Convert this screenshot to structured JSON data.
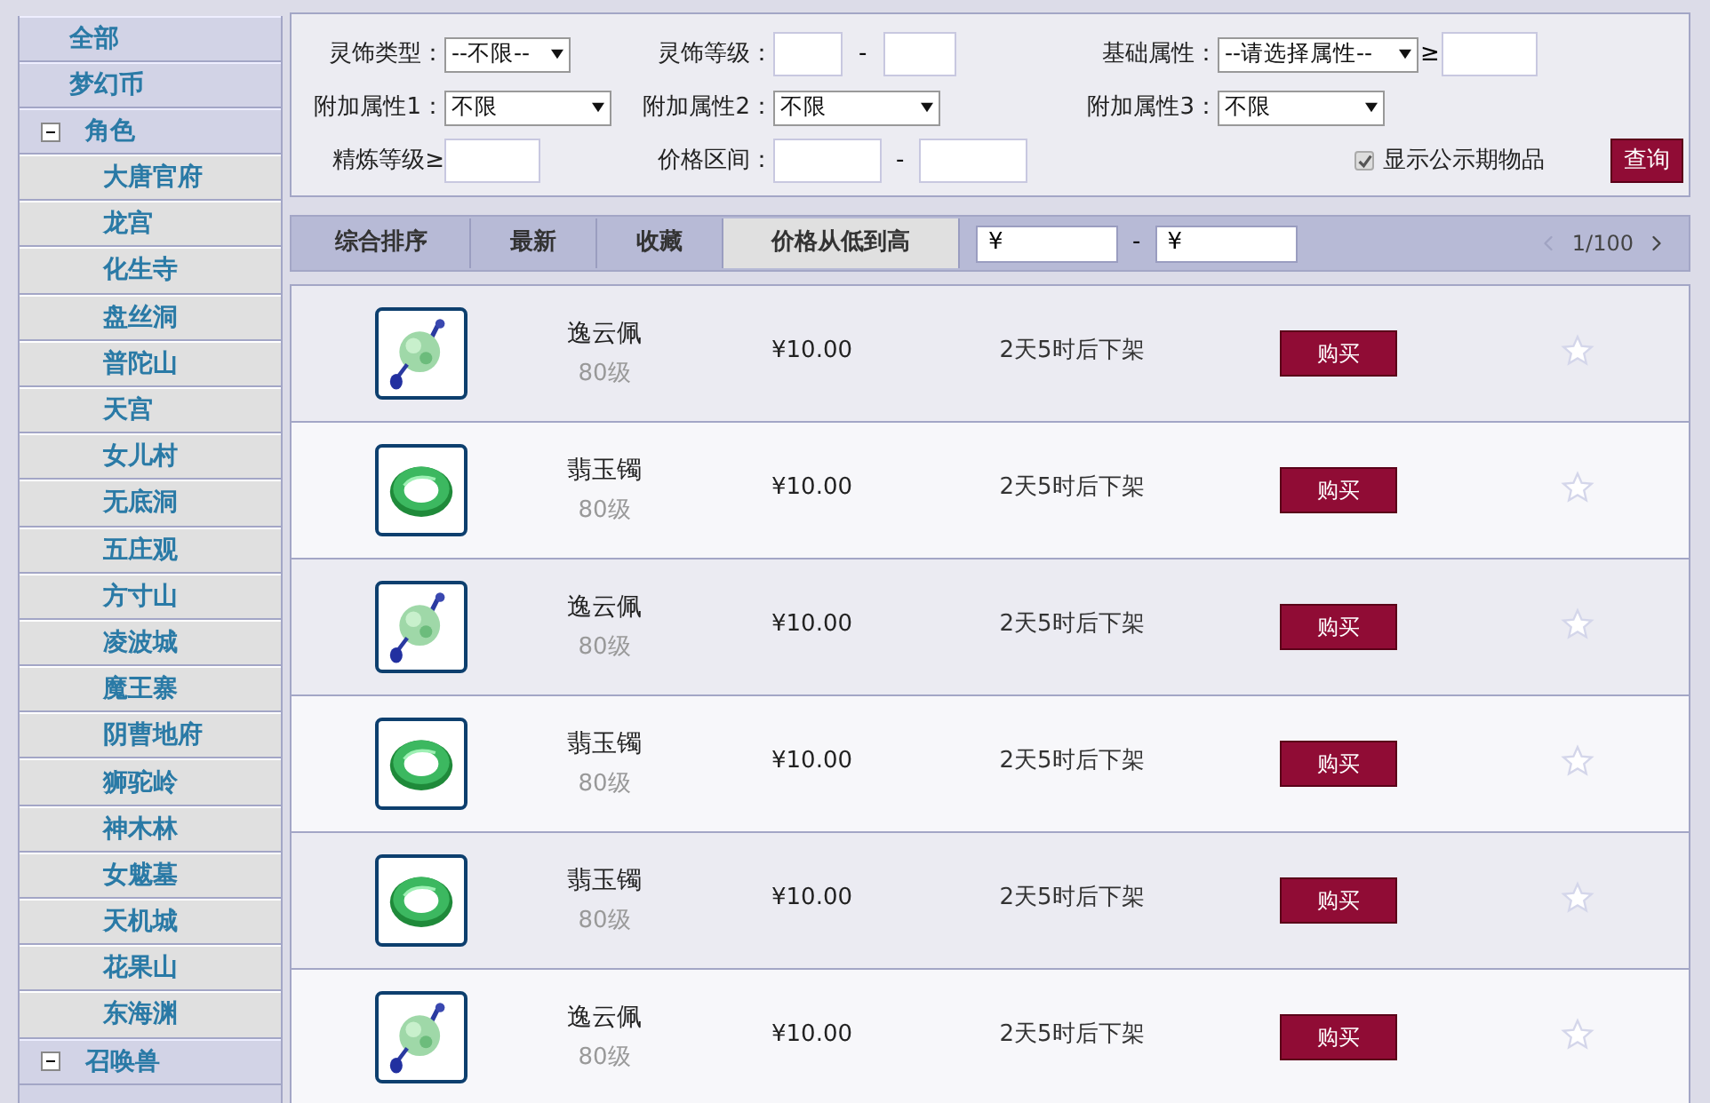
{
  "sidebar": {
    "items": [
      {
        "label": "全部",
        "kind": "top"
      },
      {
        "label": "梦幻币",
        "kind": "top"
      },
      {
        "label": "角色",
        "kind": "group",
        "expanded": true,
        "children": [
          {
            "label": "大唐官府"
          },
          {
            "label": "龙宫"
          },
          {
            "label": "化生寺"
          },
          {
            "label": "盘丝洞"
          },
          {
            "label": "普陀山"
          },
          {
            "label": "天宫"
          },
          {
            "label": "女儿村"
          },
          {
            "label": "无底洞"
          },
          {
            "label": "五庄观"
          },
          {
            "label": "方寸山"
          },
          {
            "label": "凌波城"
          },
          {
            "label": "魔王寨"
          },
          {
            "label": "阴曹地府"
          },
          {
            "label": "狮驼岭"
          },
          {
            "label": "神木林"
          },
          {
            "label": "女魃墓"
          },
          {
            "label": "天机城"
          },
          {
            "label": "花果山"
          },
          {
            "label": "东海渊"
          }
        ]
      },
      {
        "label": "召唤兽",
        "kind": "group",
        "expanded": true
      }
    ]
  },
  "filters": {
    "ornament_type": {
      "label": "灵饰类型：",
      "value": "--不限--"
    },
    "ornament_level": {
      "label": "灵饰等级：",
      "separator": "-"
    },
    "base_attribute": {
      "label": "基础属性：",
      "value": "--请选择属性--",
      "comparator": "≥"
    },
    "extra_attributes": [
      {
        "label": "附加属性1：",
        "value": "不限"
      },
      {
        "label": "附加属性2：",
        "value": "不限"
      },
      {
        "label": "附加属性3：",
        "value": "不限"
      }
    ],
    "refine_level": {
      "label": "精炼等级≥"
    },
    "price_range": {
      "label": "价格区间：",
      "separator": "-"
    },
    "show_public": {
      "label": "显示公示期物品",
      "checked": true
    },
    "query_button": "查询"
  },
  "sort_bar": {
    "tabs": [
      {
        "label": "综合排序",
        "selected": false
      },
      {
        "label": "最新",
        "selected": false
      },
      {
        "label": "收藏",
        "selected": false
      },
      {
        "label": "价格从低到高",
        "selected": true
      }
    ],
    "price_min": "¥",
    "separator": "-",
    "price_max": "¥",
    "pager": {
      "page": "1/100",
      "prev_disabled": true
    }
  },
  "items": [
    {
      "kind": "pendant",
      "name": "逸云佩",
      "level": "80级",
      "price": "¥10.00",
      "time_left": "2天5时后下架",
      "buy": "购买",
      "favorited": false
    },
    {
      "kind": "bracelet",
      "name": "翡玉镯",
      "level": "80级",
      "price": "¥10.00",
      "time_left": "2天5时后下架",
      "buy": "购买",
      "favorited": false
    },
    {
      "kind": "pendant",
      "name": "逸云佩",
      "level": "80级",
      "price": "¥10.00",
      "time_left": "2天5时后下架",
      "buy": "购买",
      "favorited": false
    },
    {
      "kind": "bracelet",
      "name": "翡玉镯",
      "level": "80级",
      "price": "¥10.00",
      "time_left": "2天5时后下架",
      "buy": "购买",
      "favorited": false
    },
    {
      "kind": "bracelet",
      "name": "翡玉镯",
      "level": "80级",
      "price": "¥10.00",
      "time_left": "2天5时后下架",
      "buy": "购买",
      "favorited": false
    },
    {
      "kind": "pendant",
      "name": "逸云佩",
      "level": "80级",
      "price": "¥10.00",
      "time_left": "2天5时后下架",
      "buy": "购买",
      "favorited": false
    }
  ]
}
